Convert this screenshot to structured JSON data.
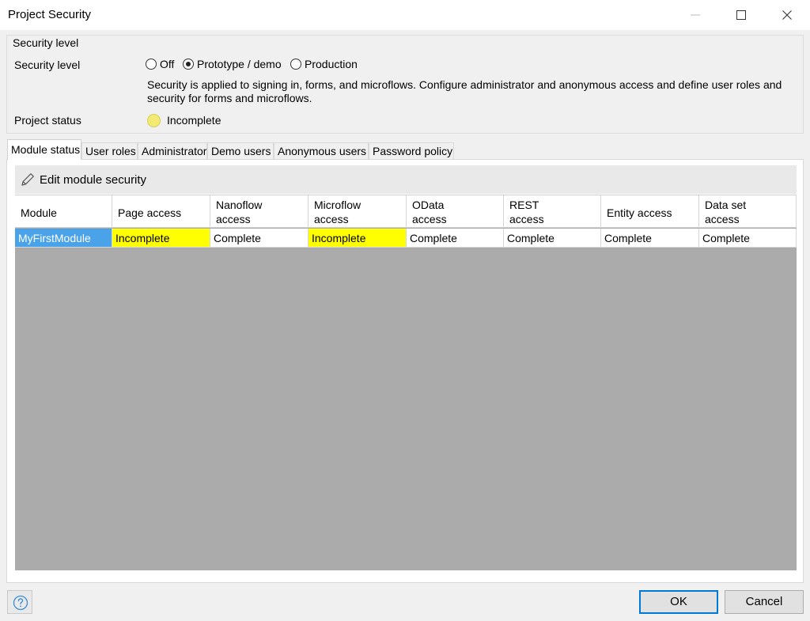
{
  "window": {
    "title": "Project Security"
  },
  "security": {
    "group_title": "Security level",
    "level_label": "Security level",
    "options": [
      {
        "label": "Off",
        "selected": false
      },
      {
        "label": "Prototype / demo",
        "selected": true
      },
      {
        "label": "Production",
        "selected": false
      }
    ],
    "description": "Security is applied to signing in, forms, and microflows. Configure administrator and anonymous access and define user roles and security for forms and microflows.",
    "status_label": "Project status",
    "status_value": "Incomplete",
    "status_color": "#f3ea74"
  },
  "tabs": [
    {
      "label": "Module status",
      "active": true
    },
    {
      "label": "User roles",
      "active": false
    },
    {
      "label": "Administrator",
      "active": false
    },
    {
      "label": "Demo users",
      "active": false
    },
    {
      "label": "Anonymous users",
      "active": false
    },
    {
      "label": "Password policy",
      "active": false
    }
  ],
  "toolbar": {
    "edit_label": "Edit module security",
    "edit_icon": "pencil-icon"
  },
  "table": {
    "columns": [
      "Module",
      "Page access",
      "Nanoflow\naccess",
      "Microflow\naccess",
      "OData\naccess",
      "REST\naccess",
      "Entity access",
      "Data set\naccess"
    ],
    "rows": [
      [
        "MyFirstModule",
        "Incomplete",
        "Complete",
        "Incomplete",
        "Complete",
        "Complete",
        "Complete",
        "Complete"
      ]
    ],
    "incomplete_color": "#ffff00",
    "selected_color": "#4aa3e8"
  },
  "footer": {
    "help_icon": "question-circle-icon",
    "ok_label": "OK",
    "cancel_label": "Cancel"
  }
}
